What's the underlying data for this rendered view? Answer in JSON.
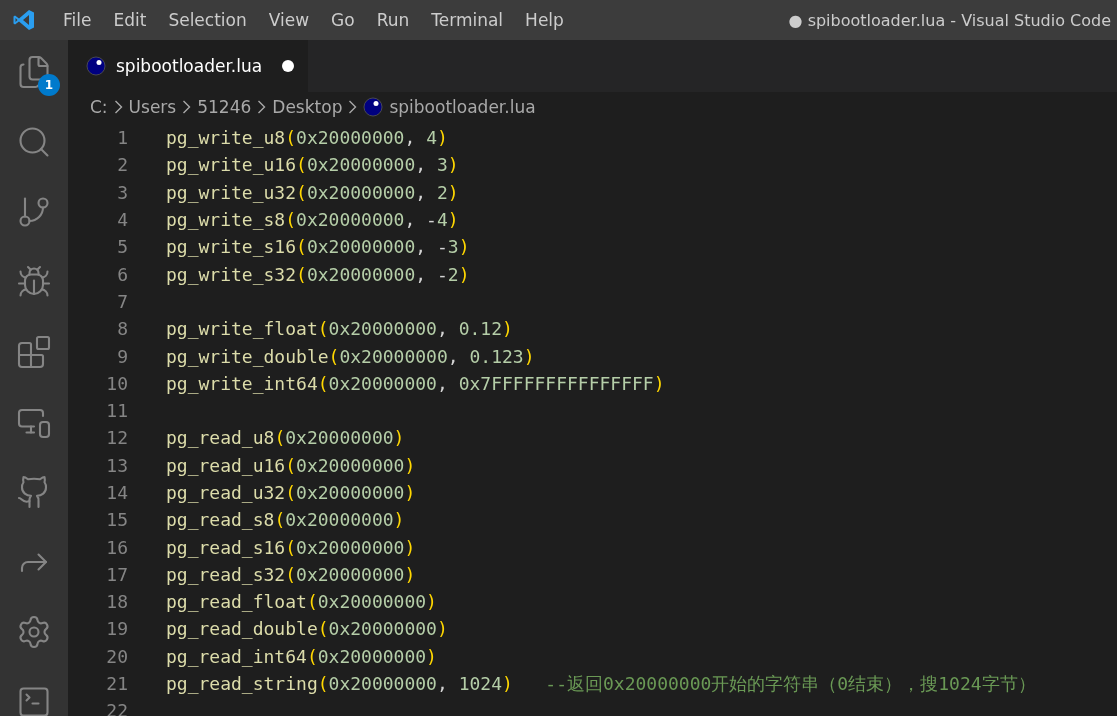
{
  "window": {
    "title": "● spibootloader.lua - Visual Studio Code"
  },
  "menu": [
    "File",
    "Edit",
    "Selection",
    "View",
    "Go",
    "Run",
    "Terminal",
    "Help"
  ],
  "activity_bar": {
    "items": [
      {
        "kind": "explorer",
        "badge": "1"
      },
      {
        "kind": "search"
      },
      {
        "kind": "source-control"
      },
      {
        "kind": "run-debug"
      },
      {
        "kind": "extensions"
      },
      {
        "kind": "remote"
      },
      {
        "kind": "github"
      },
      {
        "kind": "share"
      },
      {
        "kind": "settings-sync"
      },
      {
        "kind": "terminal"
      }
    ]
  },
  "tabs": [
    {
      "label": "spibootloader.lua",
      "selected": true,
      "dirty": true
    }
  ],
  "breadcrumb": [
    "C:",
    "Users",
    "51246",
    "Desktop",
    "spibootloader.lua"
  ],
  "editor": {
    "lines": [
      {
        "number": "1",
        "tokens": [
          {
            "kind": "function",
            "text": "pg_write_u8"
          },
          {
            "kind": "bracket",
            "text": "("
          },
          {
            "kind": "number",
            "text": "0x20000000"
          },
          {
            "kind": "plain",
            "text": ", "
          },
          {
            "kind": "number",
            "text": "4"
          },
          {
            "kind": "bracket",
            "text": ")"
          }
        ]
      },
      {
        "number": "2",
        "tokens": [
          {
            "kind": "function",
            "text": "pg_write_u16"
          },
          {
            "kind": "bracket",
            "text": "("
          },
          {
            "kind": "number",
            "text": "0x20000000"
          },
          {
            "kind": "plain",
            "text": ", "
          },
          {
            "kind": "number",
            "text": "3"
          },
          {
            "kind": "bracket",
            "text": ")"
          }
        ]
      },
      {
        "number": "3",
        "tokens": [
          {
            "kind": "function",
            "text": "pg_write_u32"
          },
          {
            "kind": "bracket",
            "text": "("
          },
          {
            "kind": "number",
            "text": "0x20000000"
          },
          {
            "kind": "plain",
            "text": ", "
          },
          {
            "kind": "number",
            "text": "2"
          },
          {
            "kind": "bracket",
            "text": ")"
          }
        ]
      },
      {
        "number": "4",
        "tokens": [
          {
            "kind": "function",
            "text": "pg_write_s8"
          },
          {
            "kind": "bracket",
            "text": "("
          },
          {
            "kind": "number",
            "text": "0x20000000"
          },
          {
            "kind": "plain",
            "text": ", -"
          },
          {
            "kind": "number",
            "text": "4"
          },
          {
            "kind": "bracket",
            "text": ")"
          }
        ]
      },
      {
        "number": "5",
        "tokens": [
          {
            "kind": "function",
            "text": "pg_write_s16"
          },
          {
            "kind": "bracket",
            "text": "("
          },
          {
            "kind": "number",
            "text": "0x20000000"
          },
          {
            "kind": "plain",
            "text": ", -"
          },
          {
            "kind": "number",
            "text": "3"
          },
          {
            "kind": "bracket",
            "text": ")"
          }
        ]
      },
      {
        "number": "6",
        "tokens": [
          {
            "kind": "function",
            "text": "pg_write_s32"
          },
          {
            "kind": "bracket",
            "text": "("
          },
          {
            "kind": "number",
            "text": "0x20000000"
          },
          {
            "kind": "plain",
            "text": ", -"
          },
          {
            "kind": "number",
            "text": "2"
          },
          {
            "kind": "bracket",
            "text": ")"
          }
        ]
      },
      {
        "number": "7"
      },
      {
        "number": "8",
        "tokens": [
          {
            "kind": "function",
            "text": "pg_write_float"
          },
          {
            "kind": "bracket",
            "text": "("
          },
          {
            "kind": "number",
            "text": "0x20000000"
          },
          {
            "kind": "plain",
            "text": ", "
          },
          {
            "kind": "number",
            "text": "0.12"
          },
          {
            "kind": "bracket",
            "text": ")"
          }
        ]
      },
      {
        "number": "9",
        "tokens": [
          {
            "kind": "function",
            "text": "pg_write_double"
          },
          {
            "kind": "bracket",
            "text": "("
          },
          {
            "kind": "number",
            "text": "0x20000000"
          },
          {
            "kind": "plain",
            "text": ", "
          },
          {
            "kind": "number",
            "text": "0.123"
          },
          {
            "kind": "bracket",
            "text": ")"
          }
        ]
      },
      {
        "number": "10",
        "tokens": [
          {
            "kind": "function",
            "text": "pg_write_int64"
          },
          {
            "kind": "bracket",
            "text": "("
          },
          {
            "kind": "number",
            "text": "0x20000000"
          },
          {
            "kind": "plain",
            "text": ", "
          },
          {
            "kind": "number",
            "text": "0x7FFFFFFFFFFFFFFF"
          },
          {
            "kind": "bracket",
            "text": ")"
          }
        ]
      },
      {
        "number": "11"
      },
      {
        "number": "12",
        "tokens": [
          {
            "kind": "function",
            "text": "pg_read_u8"
          },
          {
            "kind": "bracket",
            "text": "("
          },
          {
            "kind": "number",
            "text": "0x20000000"
          },
          {
            "kind": "bracket",
            "text": ")"
          }
        ]
      },
      {
        "number": "13",
        "tokens": [
          {
            "kind": "function",
            "text": "pg_read_u16"
          },
          {
            "kind": "bracket",
            "text": "("
          },
          {
            "kind": "number",
            "text": "0x20000000"
          },
          {
            "kind": "bracket",
            "text": ")"
          }
        ]
      },
      {
        "number": "14",
        "tokens": [
          {
            "kind": "function",
            "text": "pg_read_u32"
          },
          {
            "kind": "bracket",
            "text": "("
          },
          {
            "kind": "number",
            "text": "0x20000000"
          },
          {
            "kind": "bracket",
            "text": ")"
          }
        ]
      },
      {
        "number": "15",
        "tokens": [
          {
            "kind": "function",
            "text": "pg_read_s8"
          },
          {
            "kind": "bracket",
            "text": "("
          },
          {
            "kind": "number",
            "text": "0x20000000"
          },
          {
            "kind": "bracket",
            "text": ")"
          }
        ]
      },
      {
        "number": "16",
        "tokens": [
          {
            "kind": "function",
            "text": "pg_read_s16"
          },
          {
            "kind": "bracket",
            "text": "("
          },
          {
            "kind": "number",
            "text": "0x20000000"
          },
          {
            "kind": "bracket",
            "text": ")"
          }
        ]
      },
      {
        "number": "17",
        "tokens": [
          {
            "kind": "function",
            "text": "pg_read_s32"
          },
          {
            "kind": "bracket",
            "text": "("
          },
          {
            "kind": "number",
            "text": "0x20000000"
          },
          {
            "kind": "bracket",
            "text": ")"
          }
        ]
      },
      {
        "number": "18",
        "tokens": [
          {
            "kind": "function",
            "text": "pg_read_float"
          },
          {
            "kind": "bracket",
            "text": "("
          },
          {
            "kind": "number",
            "text": "0x20000000"
          },
          {
            "kind": "bracket",
            "text": ")"
          }
        ]
      },
      {
        "number": "19",
        "tokens": [
          {
            "kind": "function",
            "text": "pg_read_double"
          },
          {
            "kind": "bracket",
            "text": "("
          },
          {
            "kind": "number",
            "text": "0x20000000"
          },
          {
            "kind": "bracket",
            "text": ")"
          }
        ]
      },
      {
        "number": "20",
        "tokens": [
          {
            "kind": "function",
            "text": "pg_read_int64"
          },
          {
            "kind": "bracket",
            "text": "("
          },
          {
            "kind": "number",
            "text": "0x20000000"
          },
          {
            "kind": "bracket",
            "text": ")"
          }
        ]
      },
      {
        "number": "21",
        "tokens": [
          {
            "kind": "function",
            "text": "pg_read_string"
          },
          {
            "kind": "bracket",
            "text": "("
          },
          {
            "kind": "number",
            "text": "0x20000000"
          },
          {
            "kind": "plain",
            "text": ", "
          },
          {
            "kind": "number",
            "text": "1024"
          },
          {
            "kind": "bracket",
            "text": ")"
          },
          {
            "kind": "comment",
            "text": "--返回0x20000000开始的字符串（0结束），搜1024字节）"
          }
        ]
      },
      {
        "number": "22"
      }
    ]
  }
}
